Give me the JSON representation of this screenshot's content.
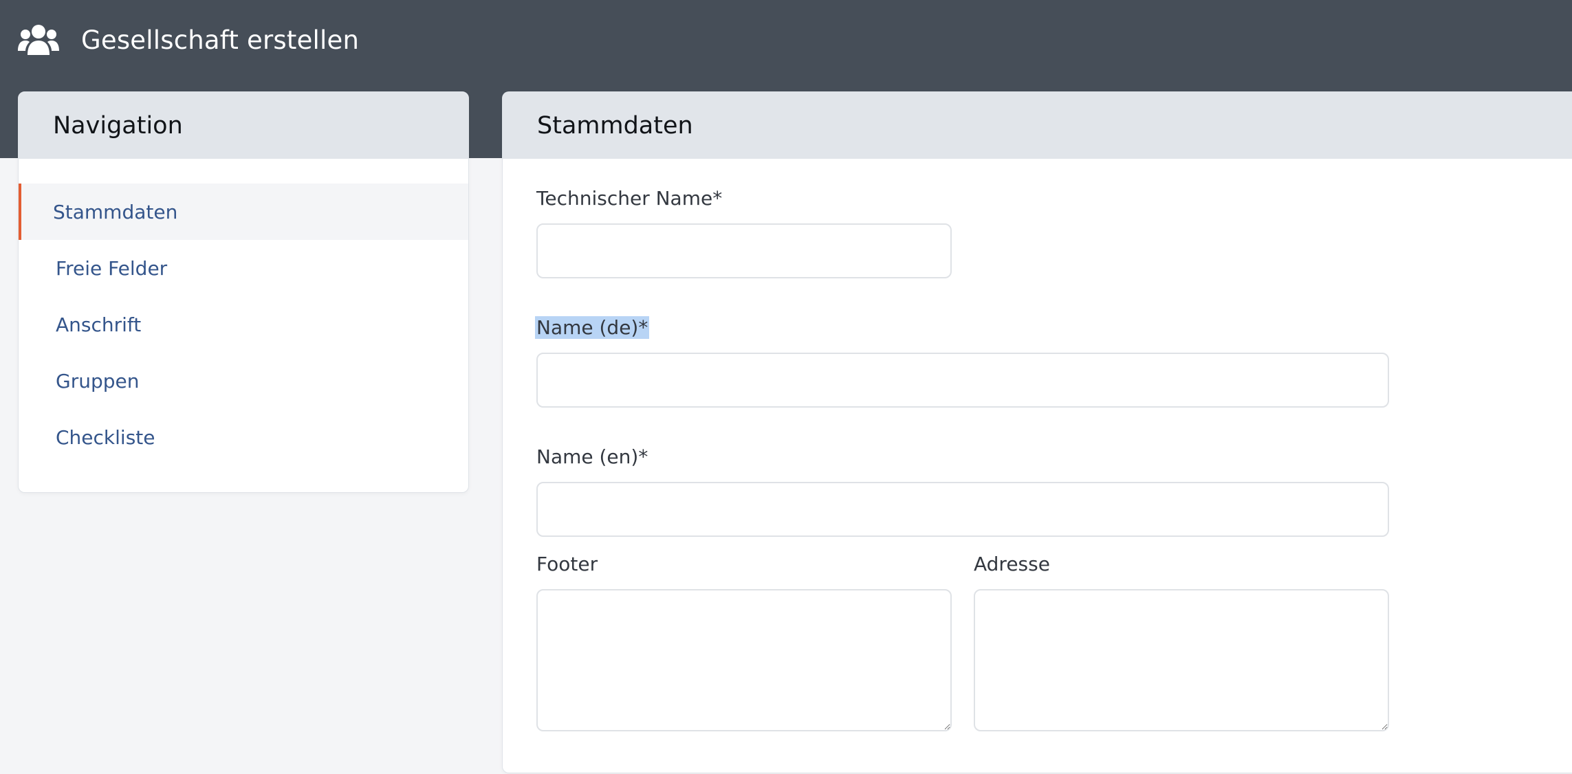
{
  "header": {
    "title": "Gesellschaft erstellen",
    "icon": "users-icon",
    "background": "#464e58"
  },
  "navigation": {
    "title": "Navigation",
    "items": [
      {
        "label": "Stammdaten",
        "active": true
      },
      {
        "label": "Freie Felder",
        "active": false
      },
      {
        "label": "Anschrift",
        "active": false
      },
      {
        "label": "Gruppen",
        "active": false
      },
      {
        "label": "Checkliste",
        "active": false
      }
    ],
    "active_accent": "#e35d32",
    "link_color": "#34558b"
  },
  "form": {
    "title": "Stammdaten",
    "fields": {
      "technical_name": {
        "label": "Technischer Name*",
        "value": ""
      },
      "name_de": {
        "label": "Name (de)*",
        "value": ""
      },
      "name_en": {
        "label": "Name (en)*",
        "value": ""
      },
      "footer": {
        "label": "Footer",
        "value": ""
      },
      "address": {
        "label": "Adresse",
        "value": ""
      }
    }
  }
}
